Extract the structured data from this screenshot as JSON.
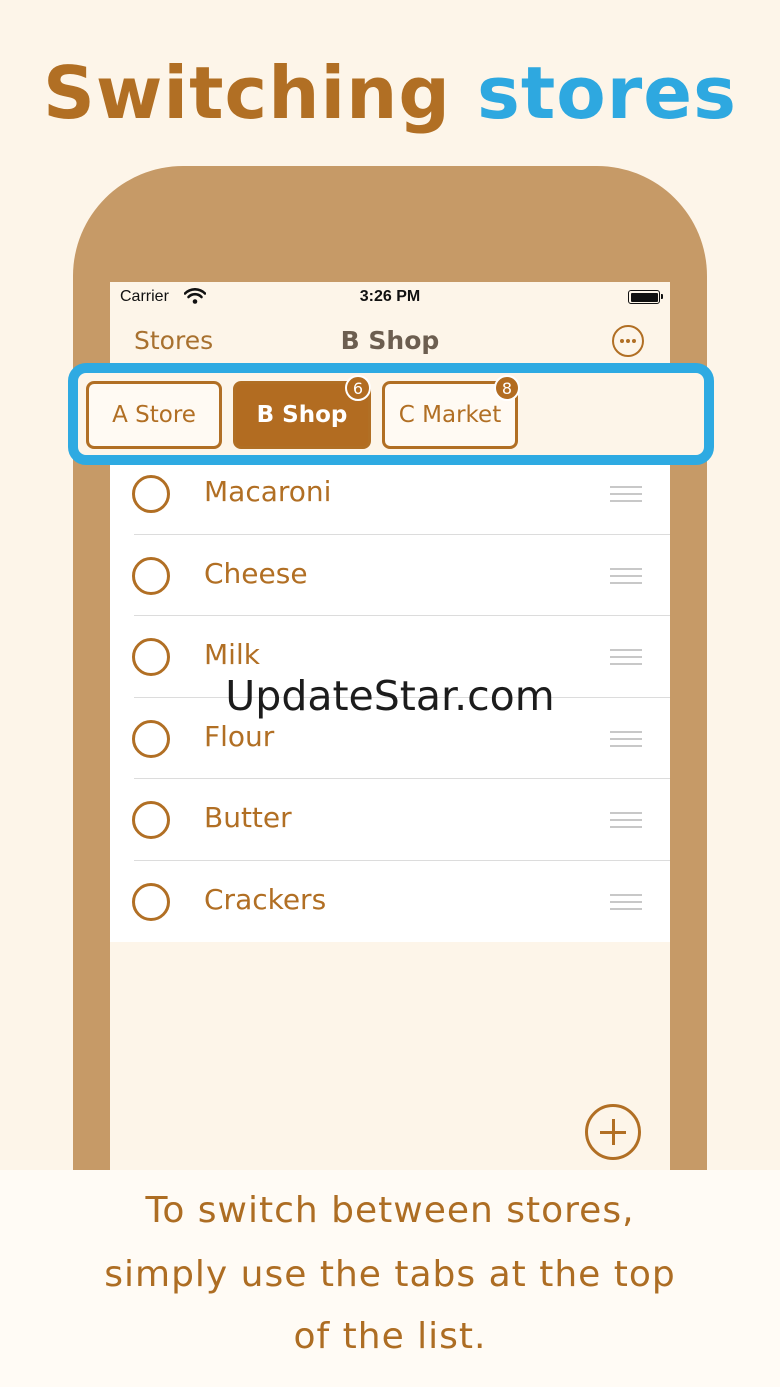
{
  "headline": {
    "word1": "Switching",
    "word2": "stores"
  },
  "colors": {
    "brown": "#b16f24",
    "blue": "#2ea8e0",
    "frame": "#c69a67"
  },
  "status_bar": {
    "carrier": "Carrier",
    "time": "3:26 PM"
  },
  "nav": {
    "back_label": "Stores",
    "title": "B Shop"
  },
  "tabs": [
    {
      "label": "A Store",
      "active": false,
      "badge": ""
    },
    {
      "label": "B Shop",
      "active": true,
      "badge": "6"
    },
    {
      "label": "C Market",
      "active": false,
      "badge": "8"
    }
  ],
  "items": [
    {
      "name": "Macaroni"
    },
    {
      "name": "Cheese"
    },
    {
      "name": "Milk"
    },
    {
      "name": "Flour"
    },
    {
      "name": "Butter"
    },
    {
      "name": "Crackers"
    }
  ],
  "watermark": "UpdateStar.com",
  "caption": {
    "line1": "To switch between stores,",
    "line2": "simply use the tabs at the top",
    "line3": "of the list."
  }
}
